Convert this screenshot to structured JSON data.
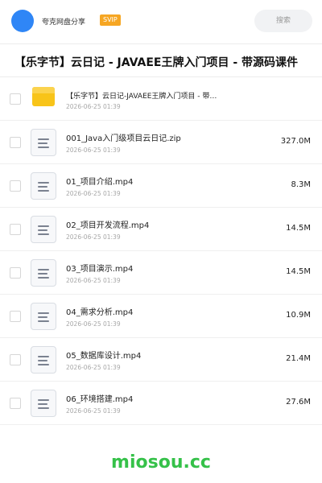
{
  "header": {
    "user_name": "夸克网盘分享",
    "badge": "SVIP",
    "search_placeholder": "搜索"
  },
  "page_title": "【乐字节】云日记 - JAVAEE王牌入门项目 - 带源码课件",
  "files": [
    {
      "type": "folder",
      "icon": "folder-icon",
      "name": "【乐字节】云日记-JAVAEE王牌入门项目 - 带…",
      "date": "2026-06-25 01:39",
      "size": ""
    },
    {
      "type": "file",
      "icon": "document-icon",
      "name": "001_Java入门级项目云日记.zip",
      "date": "2026-06-25 01:39",
      "size": "327.0M"
    },
    {
      "type": "file",
      "icon": "document-icon",
      "name": "01_项目介绍.mp4",
      "date": "2026-06-25 01:39",
      "size": "8.3M"
    },
    {
      "type": "file",
      "icon": "document-icon",
      "name": "02_项目开发流程.mp4",
      "date": "2026-06-25 01:39",
      "size": "14.5M"
    },
    {
      "type": "file",
      "icon": "document-icon",
      "name": "03_项目演示.mp4",
      "date": "2026-06-25 01:39",
      "size": "14.5M"
    },
    {
      "type": "file",
      "icon": "document-icon",
      "name": "04_需求分析.mp4",
      "date": "2026-06-25 01:39",
      "size": "10.9M"
    },
    {
      "type": "file",
      "icon": "document-icon",
      "name": "05_数据库设计.mp4",
      "date": "2026-06-25 01:39",
      "size": "21.4M"
    },
    {
      "type": "file",
      "icon": "document-icon",
      "name": "06_环境搭建.mp4",
      "date": "2026-06-25 01:39",
      "size": "27.6M"
    }
  ],
  "watermark": "miosou.cc",
  "colors": {
    "accent": "#2f86f6",
    "svip": "#f6a623",
    "folder": "#f8c419",
    "watermark": "#35c149"
  }
}
